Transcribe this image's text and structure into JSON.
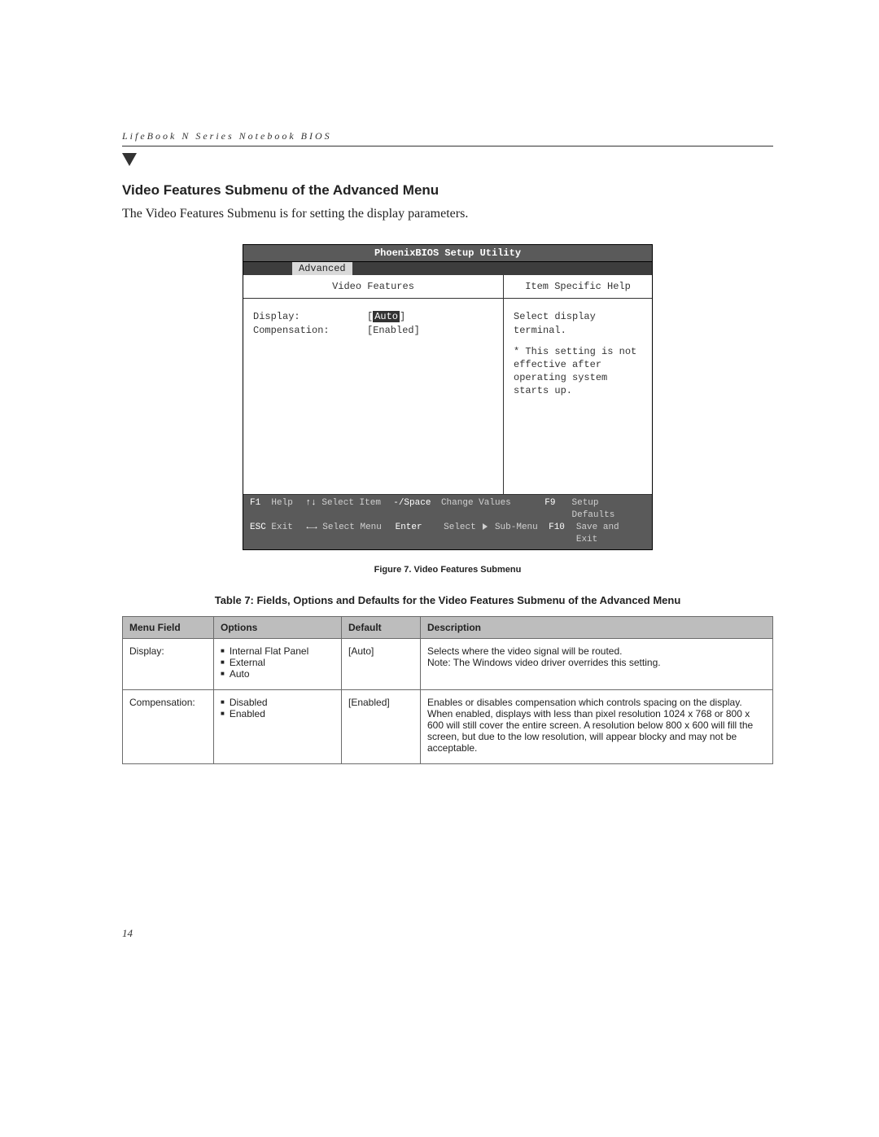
{
  "header": {
    "running_title": "LifeBook N Series Notebook BIOS"
  },
  "section": {
    "title": "Video Features Submenu of the Advanced Menu",
    "intro": "The Video Features Submenu is for setting the display parameters."
  },
  "bios": {
    "utility_title": "PhoenixBIOS Setup Utility",
    "active_tab": "Advanced",
    "left_header": "Video Features",
    "right_header": "Item Specific Help",
    "fields": [
      {
        "label": "Display:",
        "value": "Auto",
        "highlighted": true,
        "bracketed": true
      },
      {
        "label": "Compensation:",
        "value": "[Enabled]",
        "highlighted": false
      }
    ],
    "help_line1": "Select display terminal.",
    "help_rest": "* This setting is not effective after operating system starts up.",
    "footer": {
      "r1": {
        "k1": "F1",
        "l1": "Help",
        "arr1": "↑↓",
        "l2": "Select Item",
        "k2": "-/Space",
        "l3": "Change Values",
        "k3": "F9",
        "l4": "Setup Defaults"
      },
      "r2": {
        "k1": "ESC",
        "l1": "Exit",
        "arr1": "←→",
        "l2": "Select Menu",
        "k2": "Enter",
        "l3": "Select",
        "sub": "Sub-Menu",
        "k3": "F10",
        "l4": "Save and Exit"
      }
    }
  },
  "figure_caption": "Figure 7.  Video Features Submenu",
  "table_caption": "Table 7: Fields, Options and Defaults for the Video Features Submenu of the Advanced Menu",
  "table": {
    "headers": {
      "c1": "Menu Field",
      "c2": "Options",
      "c3": "Default",
      "c4": "Description"
    },
    "rows": [
      {
        "field": "Display:",
        "options": [
          "Internal Flat Panel",
          "External",
          "Auto"
        ],
        "default": "[Auto]",
        "description": "Selects where the video signal will be routed.\nNote: The Windows video driver overrides this setting."
      },
      {
        "field": "Compensation:",
        "options": [
          "Disabled",
          "Enabled"
        ],
        "default": "[Enabled]",
        "description": "Enables or disables compensation which controls spacing on the display. When enabled, displays with less than pixel resolution 1024 x 768 or 800 x 600 will still cover the entire screen. A resolution below 800 x 600 will fill the screen, but due to the low resolution, will appear blocky and may not be acceptable."
      }
    ]
  },
  "page_number": "14"
}
